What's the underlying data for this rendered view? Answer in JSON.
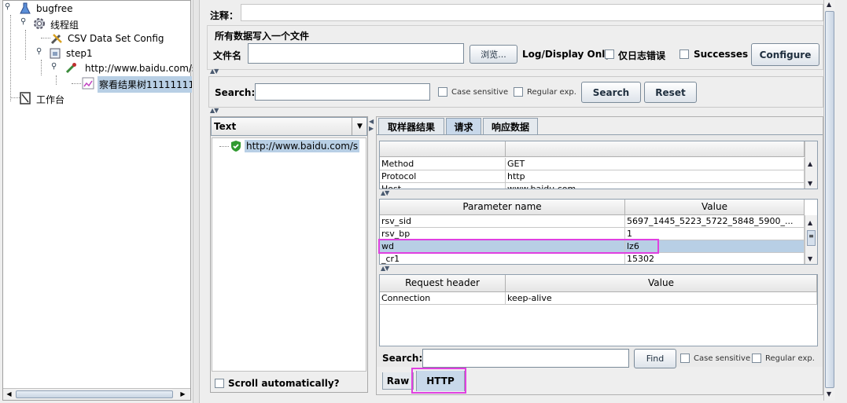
{
  "tree": {
    "items": [
      {
        "label": "bugfree",
        "icon": "flask-icon"
      },
      {
        "label": "线程组",
        "icon": "gear-icon"
      },
      {
        "label": "CSV Data Set Config",
        "icon": "tools-icon"
      },
      {
        "label": "step1",
        "icon": "controller-icon"
      },
      {
        "label": "http://www.baidu.com/s",
        "icon": "dropper-icon"
      },
      {
        "label": "察看结果树11111111",
        "icon": "chart-icon"
      },
      {
        "label": "工作台",
        "icon": "clipboard-icon"
      }
    ]
  },
  "top": {
    "comment_label": "注释：",
    "section_title": "所有数据写入一个文件",
    "filename_label": "文件名",
    "filename_value": "",
    "browse_label": "浏览...",
    "logdisplay_label": "Log/Display Only:",
    "errors_only_label": "仅日志错误",
    "successes_label": "Successes",
    "configure_label": "Configure"
  },
  "search_bar": {
    "label": "Search:",
    "value": "",
    "case_label": "Case sensitive",
    "regex_label": "Regular exp.",
    "search_btn": "Search",
    "reset_btn": "Reset"
  },
  "results": {
    "renderer": "Text",
    "items": [
      "http://www.baidu.com/s"
    ],
    "scroll_label": "Scroll automatically?"
  },
  "tabs": [
    "取样器结果",
    "请求",
    "响应数据"
  ],
  "request": {
    "method_table": [
      {
        "name": "Method",
        "value": "GET"
      },
      {
        "name": "Protocol",
        "value": "http"
      },
      {
        "name": "Host",
        "value": "www.baidu.com"
      }
    ],
    "param_headers": [
      "Parameter name",
      "Value"
    ],
    "params": [
      {
        "name": "rsv_sid",
        "value": "5697_1445_5223_5722_5848_5900_..."
      },
      {
        "name": "rsv_bp",
        "value": "1"
      },
      {
        "name": "wd",
        "value": "lz6"
      },
      {
        "name": "_cr1",
        "value": "15302"
      }
    ],
    "header_headers": [
      "Request header",
      "Value"
    ],
    "headers": [
      {
        "name": "Connection",
        "value": "keep-alive"
      }
    ],
    "search_label": "Search:",
    "search_value": "",
    "find_label": "Find",
    "case_label": "Case sensitive",
    "regex_label": "Regular exp.",
    "bottom_tabs": [
      "Raw",
      "HTTP"
    ]
  },
  "colors": {
    "highlight": "#e040e0",
    "selection": "#b8cfe5"
  }
}
